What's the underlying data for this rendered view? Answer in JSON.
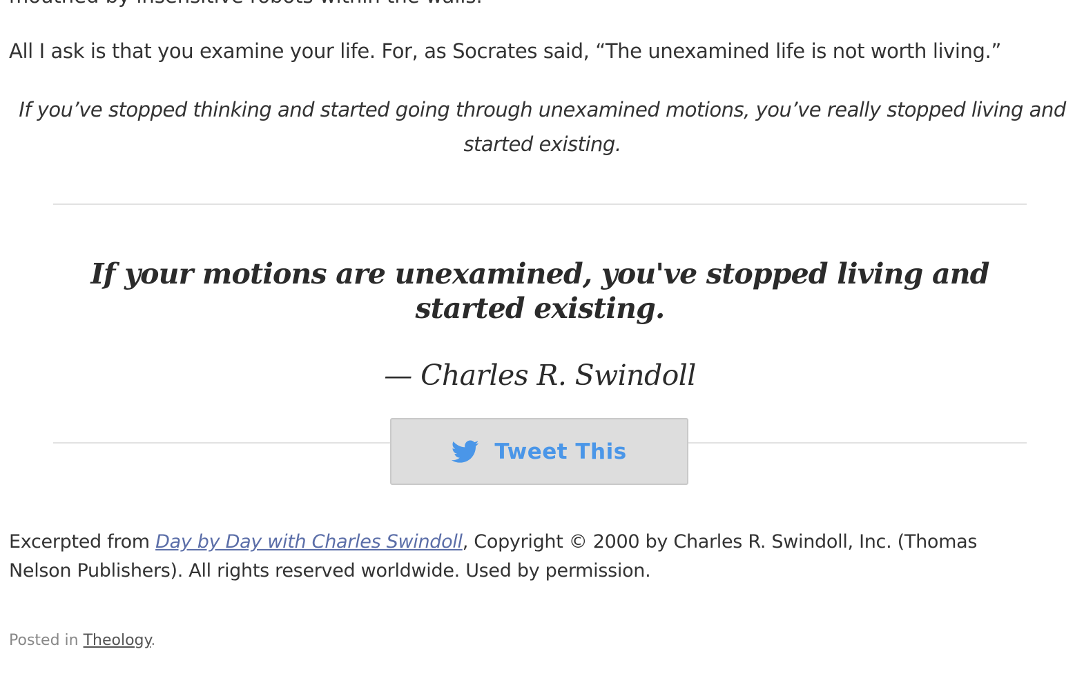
{
  "article": {
    "top_cut_text": "mouthed by insensitive robots within the walls.",
    "paragraph": "All I ask is that you examine your life. For, as Socrates said, “The unexamined life is not worth living.”",
    "italic_quote": "If you’ve stopped thinking and started going through unexamined motions, you’ve really stopped living and started existing."
  },
  "click_to_tweet": {
    "quote": "If your motions are unexamined, you've stopped living and started existing.",
    "attribution": "— Charles R. Swindoll",
    "button_label": "Tweet This",
    "button_color": "#4a96e8",
    "button_icon": "twitter-bird-icon"
  },
  "excerpt": {
    "prefix": "Excerpted from ",
    "book_link": "Day by Day with Charles Swindoll",
    "suffix": ", Copyright © 2000 by Charles R. Swindoll, Inc. (Thomas Nelson Publishers). All rights reserved worldwide. Used by permission."
  },
  "footer": {
    "posted_prefix": "Posted in ",
    "category": "Theology",
    "posted_suffix": "."
  }
}
